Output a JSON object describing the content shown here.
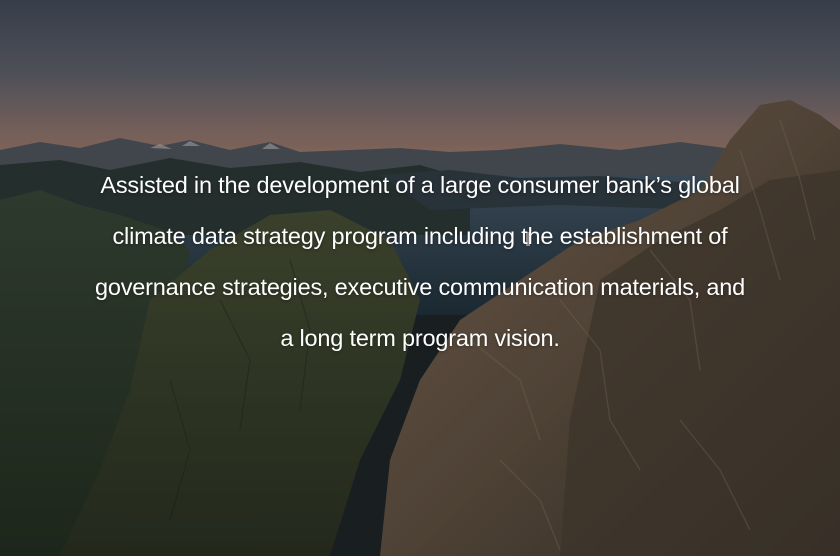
{
  "hero": {
    "image": {
      "subject": "mountain-landscape-at-dusk",
      "sky_color_top": "#4a5363",
      "sky_color_horizon": "#b28773",
      "water_color": "#2c3e4b",
      "rock_color": "#6d5a4a",
      "vegetation_color": "#3c4a30"
    },
    "caption": "Assisted in the development of a large consumer bank’s global climate data strategy program including the establishment of governance strategies, executive communication materials, and a long term program vision."
  }
}
